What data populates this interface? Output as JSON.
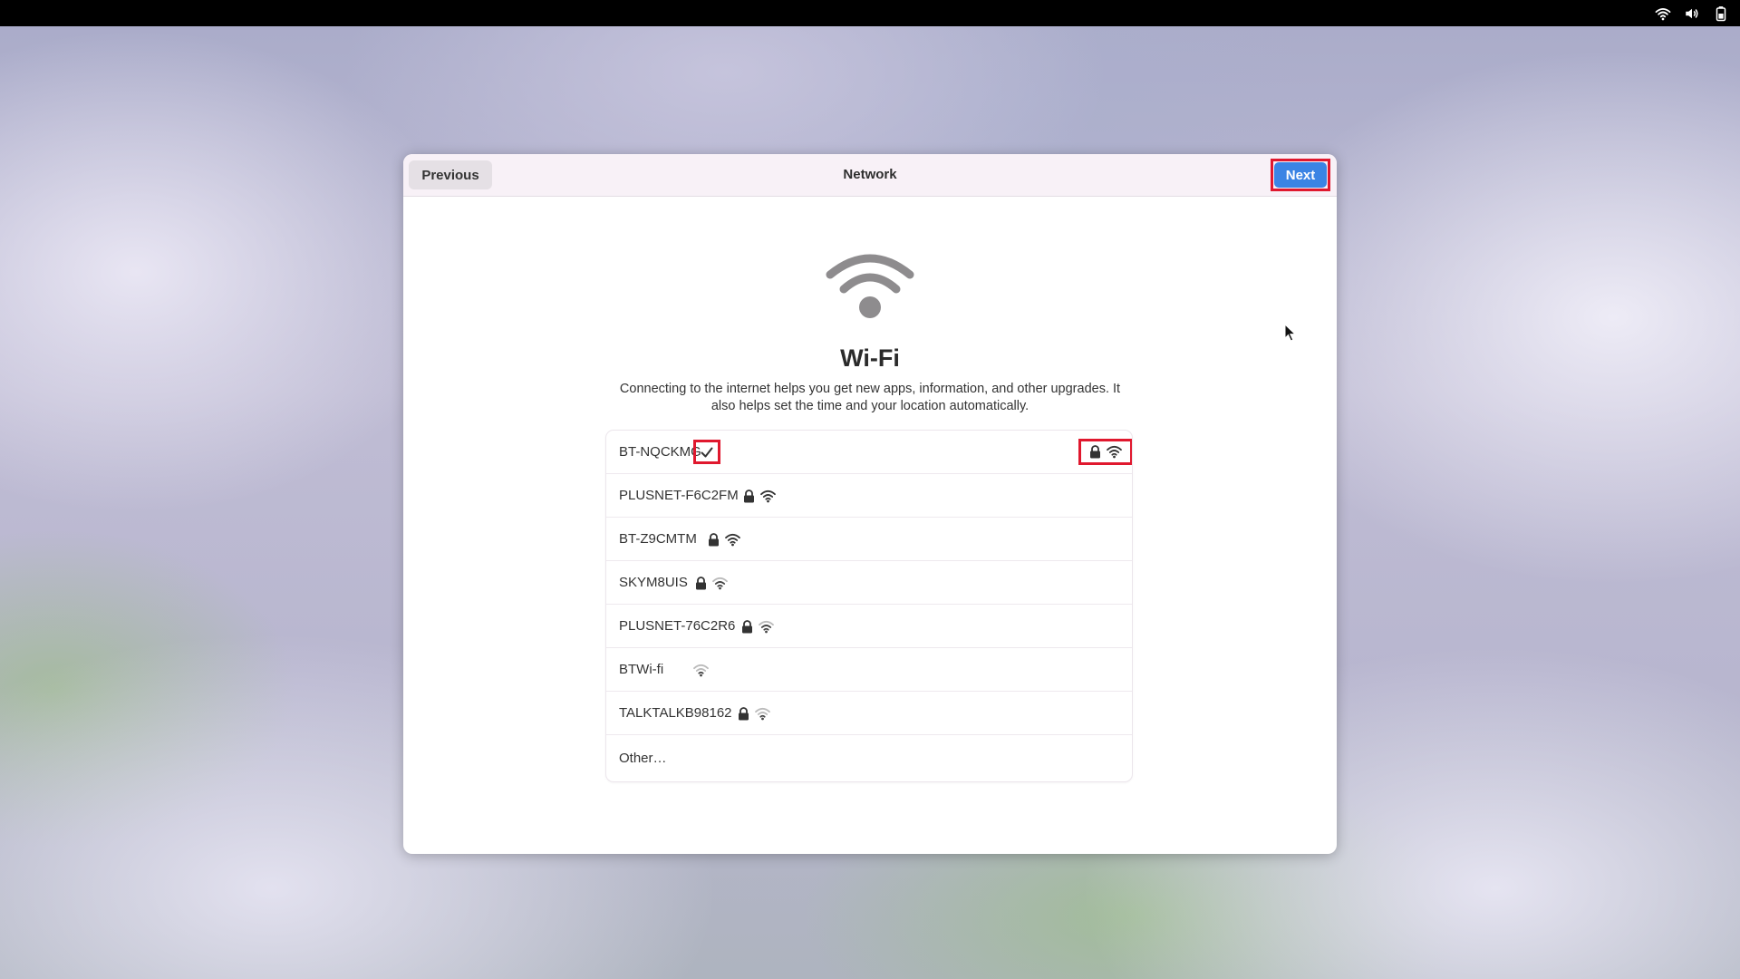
{
  "system_tray": {
    "icons": [
      "wifi-icon",
      "volume-icon",
      "battery-icon"
    ]
  },
  "dialog": {
    "title": "Network",
    "previous_label": "Previous",
    "next_label": "Next",
    "accent_color": "#3b84e4",
    "highlight_color": "#e0182e"
  },
  "page": {
    "icon": "wifi-icon",
    "heading": "Wi-Fi",
    "description": "Connecting to the internet helps you get new apps, information, and other upgrades. It also helps set the time and your location automatically."
  },
  "networks": [
    {
      "name": "BT-NQCKMG",
      "secured": true,
      "connected": true
    },
    {
      "name": "PLUSNET-F6C2FM",
      "secured": true,
      "connected": false
    },
    {
      "name": "BT-Z9CMTM",
      "secured": true,
      "connected": false
    },
    {
      "name": "SKYM8UIS",
      "secured": true,
      "connected": false
    },
    {
      "name": "PLUSNET-76C2R6",
      "secured": true,
      "connected": false
    },
    {
      "name": "BTWi-fi",
      "secured": false,
      "connected": false
    },
    {
      "name": "TALKTALKB98162",
      "secured": true,
      "connected": false
    }
  ],
  "other_label": "Other…"
}
